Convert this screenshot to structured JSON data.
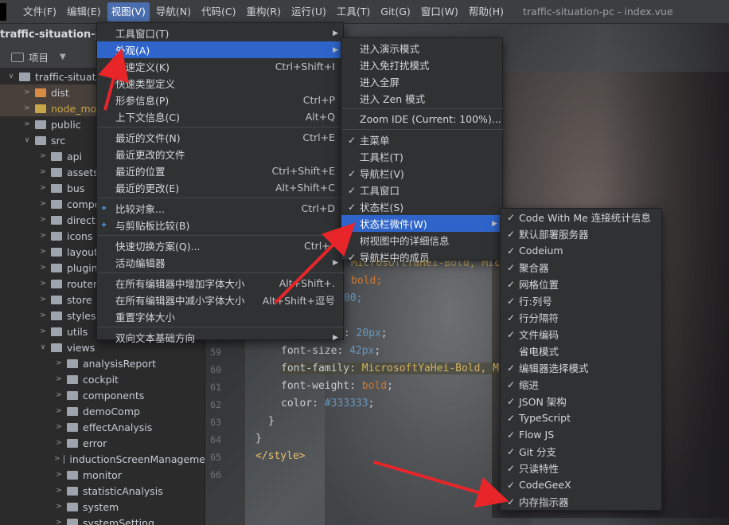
{
  "menubar": {
    "items": [
      "文件(F)",
      "编辑(E)",
      "视图(V)",
      "导航(N)",
      "代码(C)",
      "重构(R)",
      "运行(U)",
      "工具(T)",
      "Git(G)",
      "窗口(W)",
      "帮助(H)"
    ],
    "window_title": "traffic-situation-pc - index.vue"
  },
  "project": {
    "name": "traffic-situation-pc",
    "view_label": "项目"
  },
  "tree": [
    {
      "label": "traffic-situati",
      "color": "normal"
    },
    {
      "label": "dist",
      "color": "orange"
    },
    {
      "label": "node_mo",
      "color": "yellow"
    },
    {
      "label": "public",
      "color": "normal"
    },
    {
      "label": "src",
      "color": "normal"
    },
    {
      "label": "api",
      "color": "normal"
    },
    {
      "label": "assets",
      "color": "normal"
    },
    {
      "label": "bus",
      "color": "normal"
    },
    {
      "label": "compo",
      "color": "normal"
    },
    {
      "label": "directiv",
      "color": "normal"
    },
    {
      "label": "icons",
      "color": "normal"
    },
    {
      "label": "layout",
      "color": "normal"
    },
    {
      "label": "plugins",
      "color": "normal"
    },
    {
      "label": "router",
      "color": "normal"
    },
    {
      "label": "store",
      "color": "normal"
    },
    {
      "label": "styles",
      "color": "normal"
    },
    {
      "label": "utils",
      "color": "normal"
    },
    {
      "label": "views",
      "color": "normal"
    },
    {
      "label": "analysisReport",
      "color": "normal"
    },
    {
      "label": "cockpit",
      "color": "normal"
    },
    {
      "label": "components",
      "color": "normal"
    },
    {
      "label": "demoComp",
      "color": "normal"
    },
    {
      "label": "effectAnalysis",
      "color": "normal"
    },
    {
      "label": "error",
      "color": "normal"
    },
    {
      "label": "inductionScreenManageme",
      "color": "normal"
    },
    {
      "label": "monitor",
      "color": "normal"
    },
    {
      "label": "statisticAnalysis",
      "color": "normal"
    },
    {
      "label": "system",
      "color": "normal"
    },
    {
      "label": "systemSetting",
      "color": "normal"
    }
  ],
  "editor": {
    "line_numbers": [
      "59",
      "60",
      "61",
      "62",
      "63",
      "64",
      "65",
      "66"
    ],
    "code": {
      "l_a1": "MicrosoftYaHei-Bold, Mic",
      "l_a2": "bold;",
      "l_a3": "00;",
      "l_b": "t: ",
      "l_b_val": "20px",
      "l59_prop": "font-size: ",
      "l59_val": "42px",
      "l60_prop": "font-family: ",
      "l60_val": "MicrosoftYaHei-Bold, M",
      "l61_prop": "font-weight: ",
      "l61_val": "bold",
      "l62_prop": "color: ",
      "l62_val": "#333333",
      "semi": ";",
      "l63": "}",
      "l64": "}",
      "l65": "</style>"
    }
  },
  "view_menu": [
    {
      "label": "工具窗口(T)",
      "shortcut": "",
      "sub": true
    },
    {
      "label": "外观(A)",
      "shortcut": "",
      "sub": true,
      "selected": true
    },
    {
      "label": "快速定义(K)",
      "shortcut": "Ctrl+Shift+I"
    },
    {
      "label": "快速类型定义",
      "shortcut": ""
    },
    {
      "label": "形参信息(P)",
      "shortcut": "Ctrl+P"
    },
    {
      "label": "上下文信息(C)",
      "shortcut": "Alt+Q"
    },
    {
      "label": "最近的文件(N)",
      "shortcut": "Ctrl+E"
    },
    {
      "label": "最近更改的文件",
      "shortcut": ""
    },
    {
      "label": "最近的位置",
      "shortcut": "Ctrl+Shift+E"
    },
    {
      "label": "最近的更改(E)",
      "shortcut": "Alt+Shift+C"
    },
    {
      "label": "比较对象...",
      "shortcut": "Ctrl+D",
      "icon": true
    },
    {
      "label": "与剪贴板比较(B)",
      "shortcut": "",
      "icon": true
    },
    {
      "label": "快速切换方案(Q)...",
      "shortcut": "Ctrl+`"
    },
    {
      "label": "活动编辑器",
      "shortcut": "",
      "sub": true
    },
    {
      "label": "在所有编辑器中增加字体大小",
      "shortcut": "Alt+Shift+."
    },
    {
      "label": "在所有编辑器中减小字体大小",
      "shortcut": "Alt+Shift+逗号"
    },
    {
      "label": "重置字体大小",
      "shortcut": ""
    },
    {
      "label": "双向文本基础方向",
      "shortcut": "",
      "sub": true
    }
  ],
  "appearance_menu": [
    {
      "label": "进入演示模式"
    },
    {
      "label": "进入免打扰模式"
    },
    {
      "label": "进入全屏"
    },
    {
      "label": "进入 Zen 模式"
    },
    {
      "label": "Zoom IDE (Current: 100%)..."
    },
    {
      "label": "主菜单",
      "checked": true
    },
    {
      "label": "工具栏(T)"
    },
    {
      "label": "导航栏(V)",
      "checked": true
    },
    {
      "label": "工具窗口",
      "checked": true
    },
    {
      "label": "状态栏(S)",
      "checked": true
    },
    {
      "label": "状态栏微件(W)",
      "sub": true,
      "selected": true
    },
    {
      "label": "树视图中的详细信息"
    },
    {
      "label": "导航栏中的成员",
      "checked": true
    }
  ],
  "widgets_menu": [
    {
      "label": "Code With Me 连接统计信息",
      "checked": true
    },
    {
      "label": "默认部署服务器",
      "checked": true
    },
    {
      "label": "Codeium",
      "checked": true
    },
    {
      "label": "聚合器",
      "checked": true
    },
    {
      "label": "网格位置",
      "checked": true
    },
    {
      "label": "行:列号",
      "checked": true
    },
    {
      "label": "行分隔符",
      "checked": true
    },
    {
      "label": "文件编码",
      "checked": true
    },
    {
      "label": "省电模式",
      "checked": false
    },
    {
      "label": "编辑器选择模式",
      "checked": true
    },
    {
      "label": "缩进",
      "checked": true
    },
    {
      "label": "JSON 架构",
      "checked": true
    },
    {
      "label": "TypeScript",
      "checked": true
    },
    {
      "label": "Flow JS",
      "checked": true
    },
    {
      "label": "Git 分支",
      "checked": true
    },
    {
      "label": "只读特性",
      "checked": true
    },
    {
      "label": "CodeGeeX",
      "checked": true
    },
    {
      "label": "内存指示器",
      "checked": true
    }
  ],
  "colors": {
    "menu_selected": "#2f65ca",
    "menubar_active": "#4b6eaf",
    "annotation_arrow": "#e8262a"
  }
}
